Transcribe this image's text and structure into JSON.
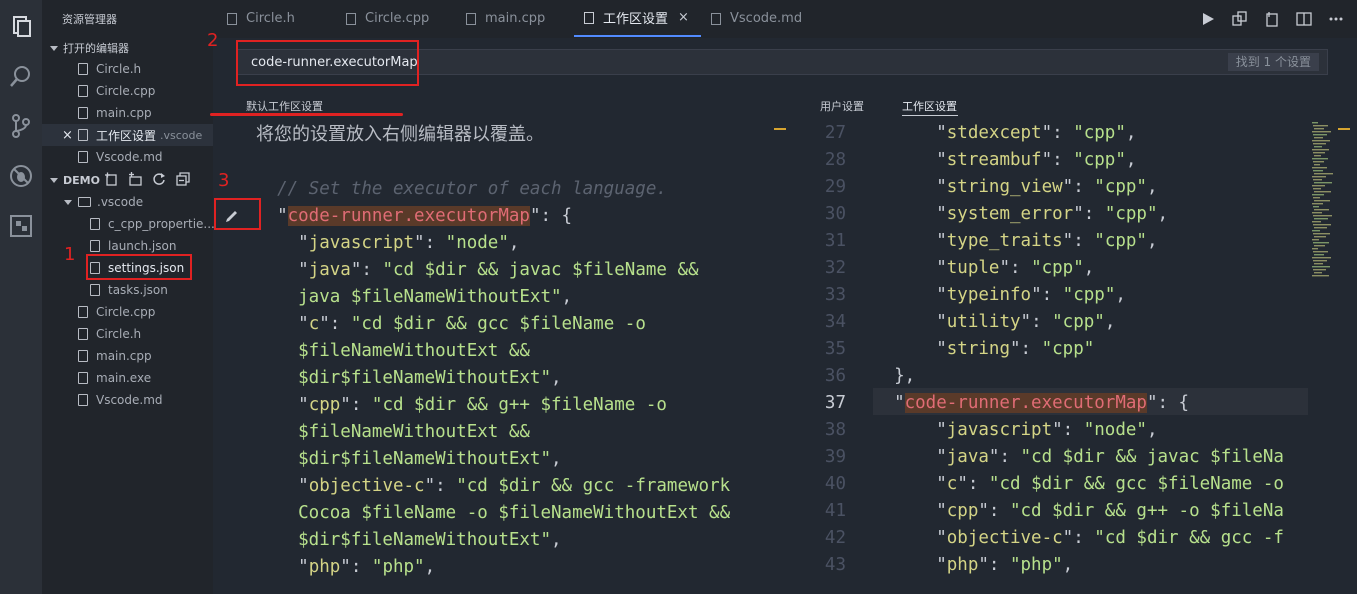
{
  "activity_bar": {
    "icons": [
      "explorer-icon",
      "search-icon",
      "source-control-icon",
      "debug-icon",
      "extensions-icon"
    ]
  },
  "sidebar": {
    "title": "资源管理器",
    "open_editors_label": "打开的编辑器",
    "open_editors": [
      {
        "label": "Circle.h"
      },
      {
        "label": "Circle.cpp"
      },
      {
        "label": "main.cpp"
      },
      {
        "label": "工作区设置",
        "sub": ".vscode",
        "close": "×"
      },
      {
        "label": "Vscode.md"
      }
    ],
    "demo_label": "DEMO",
    "vscode_folder": ".vscode",
    "vscode_files": [
      "c_cpp_propertie...",
      "launch.json",
      "settings.json",
      "tasks.json"
    ],
    "demo_files": [
      "Circle.cpp",
      "Circle.h",
      "main.cpp",
      "main.exe",
      "Vscode.md"
    ]
  },
  "tabs": [
    {
      "label": "Circle.h"
    },
    {
      "label": "Circle.cpp"
    },
    {
      "label": "main.cpp"
    },
    {
      "label": "工作区设置",
      "close": "×"
    },
    {
      "label": "Vscode.md"
    }
  ],
  "search": {
    "value": "code-runner.executorMap",
    "result_count": "找到 1 个设置"
  },
  "left_panel": {
    "label": "默认工作区设置",
    "hint": "将您的设置放入右侧编辑器以覆盖。"
  },
  "right_panel": {
    "user_label": "用户设置",
    "workspace_label": "工作区设置"
  },
  "left_code": [
    [
      {
        "t": "cm",
        "v": "  // Set the executor of each language."
      }
    ],
    [
      {
        "t": "p",
        "v": "  \""
      },
      {
        "t": "hl",
        "v": "code-runner.executorMap"
      },
      {
        "t": "p",
        "v": "\": {"
      }
    ],
    [
      {
        "t": "p",
        "v": "    \""
      },
      {
        "t": "k",
        "v": "javascript"
      },
      {
        "t": "p",
        "v": "\": "
      },
      {
        "t": "s",
        "v": "\"node\""
      },
      {
        "t": "p",
        "v": ","
      }
    ],
    [
      {
        "t": "p",
        "v": "    \""
      },
      {
        "t": "k",
        "v": "java"
      },
      {
        "t": "p",
        "v": "\": "
      },
      {
        "t": "s",
        "v": "\"cd $dir && javac $fileName &&"
      }
    ],
    [
      {
        "t": "s",
        "v": "    java $fileNameWithoutExt\""
      },
      {
        "t": "p",
        "v": ","
      }
    ],
    [
      {
        "t": "p",
        "v": "    \""
      },
      {
        "t": "k",
        "v": "c"
      },
      {
        "t": "p",
        "v": "\": "
      },
      {
        "t": "s",
        "v": "\"cd $dir && gcc $fileName -o"
      }
    ],
    [
      {
        "t": "s",
        "v": "    $fileNameWithoutExt &&"
      }
    ],
    [
      {
        "t": "s",
        "v": "    $dir$fileNameWithoutExt\""
      },
      {
        "t": "p",
        "v": ","
      }
    ],
    [
      {
        "t": "p",
        "v": "    \""
      },
      {
        "t": "k",
        "v": "cpp"
      },
      {
        "t": "p",
        "v": "\": "
      },
      {
        "t": "s",
        "v": "\"cd $dir && g++ $fileName -o"
      }
    ],
    [
      {
        "t": "s",
        "v": "    $fileNameWithoutExt &&"
      }
    ],
    [
      {
        "t": "s",
        "v": "    $dir$fileNameWithoutExt\""
      },
      {
        "t": "p",
        "v": ","
      }
    ],
    [
      {
        "t": "p",
        "v": "    \""
      },
      {
        "t": "k",
        "v": "objective-c"
      },
      {
        "t": "p",
        "v": "\": "
      },
      {
        "t": "s",
        "v": "\"cd $dir && gcc -framework"
      }
    ],
    [
      {
        "t": "s",
        "v": "    Cocoa $fileName -o $fileNameWithoutExt &&"
      }
    ],
    [
      {
        "t": "s",
        "v": "    $dir$fileNameWithoutExt\""
      },
      {
        "t": "p",
        "v": ","
      }
    ],
    [
      {
        "t": "p",
        "v": "    \""
      },
      {
        "t": "k",
        "v": "php"
      },
      {
        "t": "p",
        "v": "\": "
      },
      {
        "t": "s",
        "v": "\"php\""
      },
      {
        "t": "p",
        "v": ","
      }
    ]
  ],
  "right_line_numbers": [
    "27",
    "28",
    "29",
    "30",
    "31",
    "32",
    "33",
    "34",
    "35",
    "36",
    "37",
    "38",
    "39",
    "40",
    "41",
    "42",
    "43"
  ],
  "current_line": "37",
  "right_code": [
    [
      {
        "t": "p",
        "v": "      \""
      },
      {
        "t": "k",
        "v": "stdexcept"
      },
      {
        "t": "p",
        "v": "\": "
      },
      {
        "t": "s",
        "v": "\"cpp\""
      },
      {
        "t": "p",
        "v": ","
      }
    ],
    [
      {
        "t": "p",
        "v": "      \""
      },
      {
        "t": "k",
        "v": "streambuf"
      },
      {
        "t": "p",
        "v": "\": "
      },
      {
        "t": "s",
        "v": "\"cpp\""
      },
      {
        "t": "p",
        "v": ","
      }
    ],
    [
      {
        "t": "p",
        "v": "      \""
      },
      {
        "t": "k",
        "v": "string_view"
      },
      {
        "t": "p",
        "v": "\": "
      },
      {
        "t": "s",
        "v": "\"cpp\""
      },
      {
        "t": "p",
        "v": ","
      }
    ],
    [
      {
        "t": "p",
        "v": "      \""
      },
      {
        "t": "k",
        "v": "system_error"
      },
      {
        "t": "p",
        "v": "\": "
      },
      {
        "t": "s",
        "v": "\"cpp\""
      },
      {
        "t": "p",
        "v": ","
      }
    ],
    [
      {
        "t": "p",
        "v": "      \""
      },
      {
        "t": "k",
        "v": "type_traits"
      },
      {
        "t": "p",
        "v": "\": "
      },
      {
        "t": "s",
        "v": "\"cpp\""
      },
      {
        "t": "p",
        "v": ","
      }
    ],
    [
      {
        "t": "p",
        "v": "      \""
      },
      {
        "t": "k",
        "v": "tuple"
      },
      {
        "t": "p",
        "v": "\": "
      },
      {
        "t": "s",
        "v": "\"cpp\""
      },
      {
        "t": "p",
        "v": ","
      }
    ],
    [
      {
        "t": "p",
        "v": "      \""
      },
      {
        "t": "k",
        "v": "typeinfo"
      },
      {
        "t": "p",
        "v": "\": "
      },
      {
        "t": "s",
        "v": "\"cpp\""
      },
      {
        "t": "p",
        "v": ","
      }
    ],
    [
      {
        "t": "p",
        "v": "      \""
      },
      {
        "t": "k",
        "v": "utility"
      },
      {
        "t": "p",
        "v": "\": "
      },
      {
        "t": "s",
        "v": "\"cpp\""
      },
      {
        "t": "p",
        "v": ","
      }
    ],
    [
      {
        "t": "p",
        "v": "      \""
      },
      {
        "t": "k",
        "v": "string"
      },
      {
        "t": "p",
        "v": "\": "
      },
      {
        "t": "s",
        "v": "\"cpp\""
      }
    ],
    [
      {
        "t": "p",
        "v": "  },"
      }
    ],
    [
      {
        "t": "p",
        "v": "  \""
      },
      {
        "t": "hl",
        "v": "code-runner.executorMap"
      },
      {
        "t": "p",
        "v": "\": {"
      }
    ],
    [
      {
        "t": "p",
        "v": "      \""
      },
      {
        "t": "k",
        "v": "javascript"
      },
      {
        "t": "p",
        "v": "\": "
      },
      {
        "t": "s",
        "v": "\"node\""
      },
      {
        "t": "p",
        "v": ","
      }
    ],
    [
      {
        "t": "p",
        "v": "      \""
      },
      {
        "t": "k",
        "v": "java"
      },
      {
        "t": "p",
        "v": "\": "
      },
      {
        "t": "s",
        "v": "\"cd $dir && javac $fileNa"
      }
    ],
    [
      {
        "t": "p",
        "v": "      \""
      },
      {
        "t": "k",
        "v": "c"
      },
      {
        "t": "p",
        "v": "\": "
      },
      {
        "t": "s",
        "v": "\"cd $dir && gcc $fileName -o"
      }
    ],
    [
      {
        "t": "p",
        "v": "      \""
      },
      {
        "t": "k",
        "v": "cpp"
      },
      {
        "t": "p",
        "v": "\": "
      },
      {
        "t": "s",
        "v": "\"cd $dir && g++ -o $fileNa"
      }
    ],
    [
      {
        "t": "p",
        "v": "      \""
      },
      {
        "t": "k",
        "v": "objective-c"
      },
      {
        "t": "p",
        "v": "\": "
      },
      {
        "t": "s",
        "v": "\"cd $dir && gcc -f"
      }
    ],
    [
      {
        "t": "p",
        "v": "      \""
      },
      {
        "t": "k",
        "v": "php"
      },
      {
        "t": "p",
        "v": "\": "
      },
      {
        "t": "s",
        "v": "\"php\""
      },
      {
        "t": "p",
        "v": ","
      }
    ]
  ],
  "annotations": [
    "1",
    "2",
    "3"
  ],
  "colors": {
    "accent": "#528bff",
    "annotation": "#e02222",
    "highlight": "#5a3a29"
  }
}
